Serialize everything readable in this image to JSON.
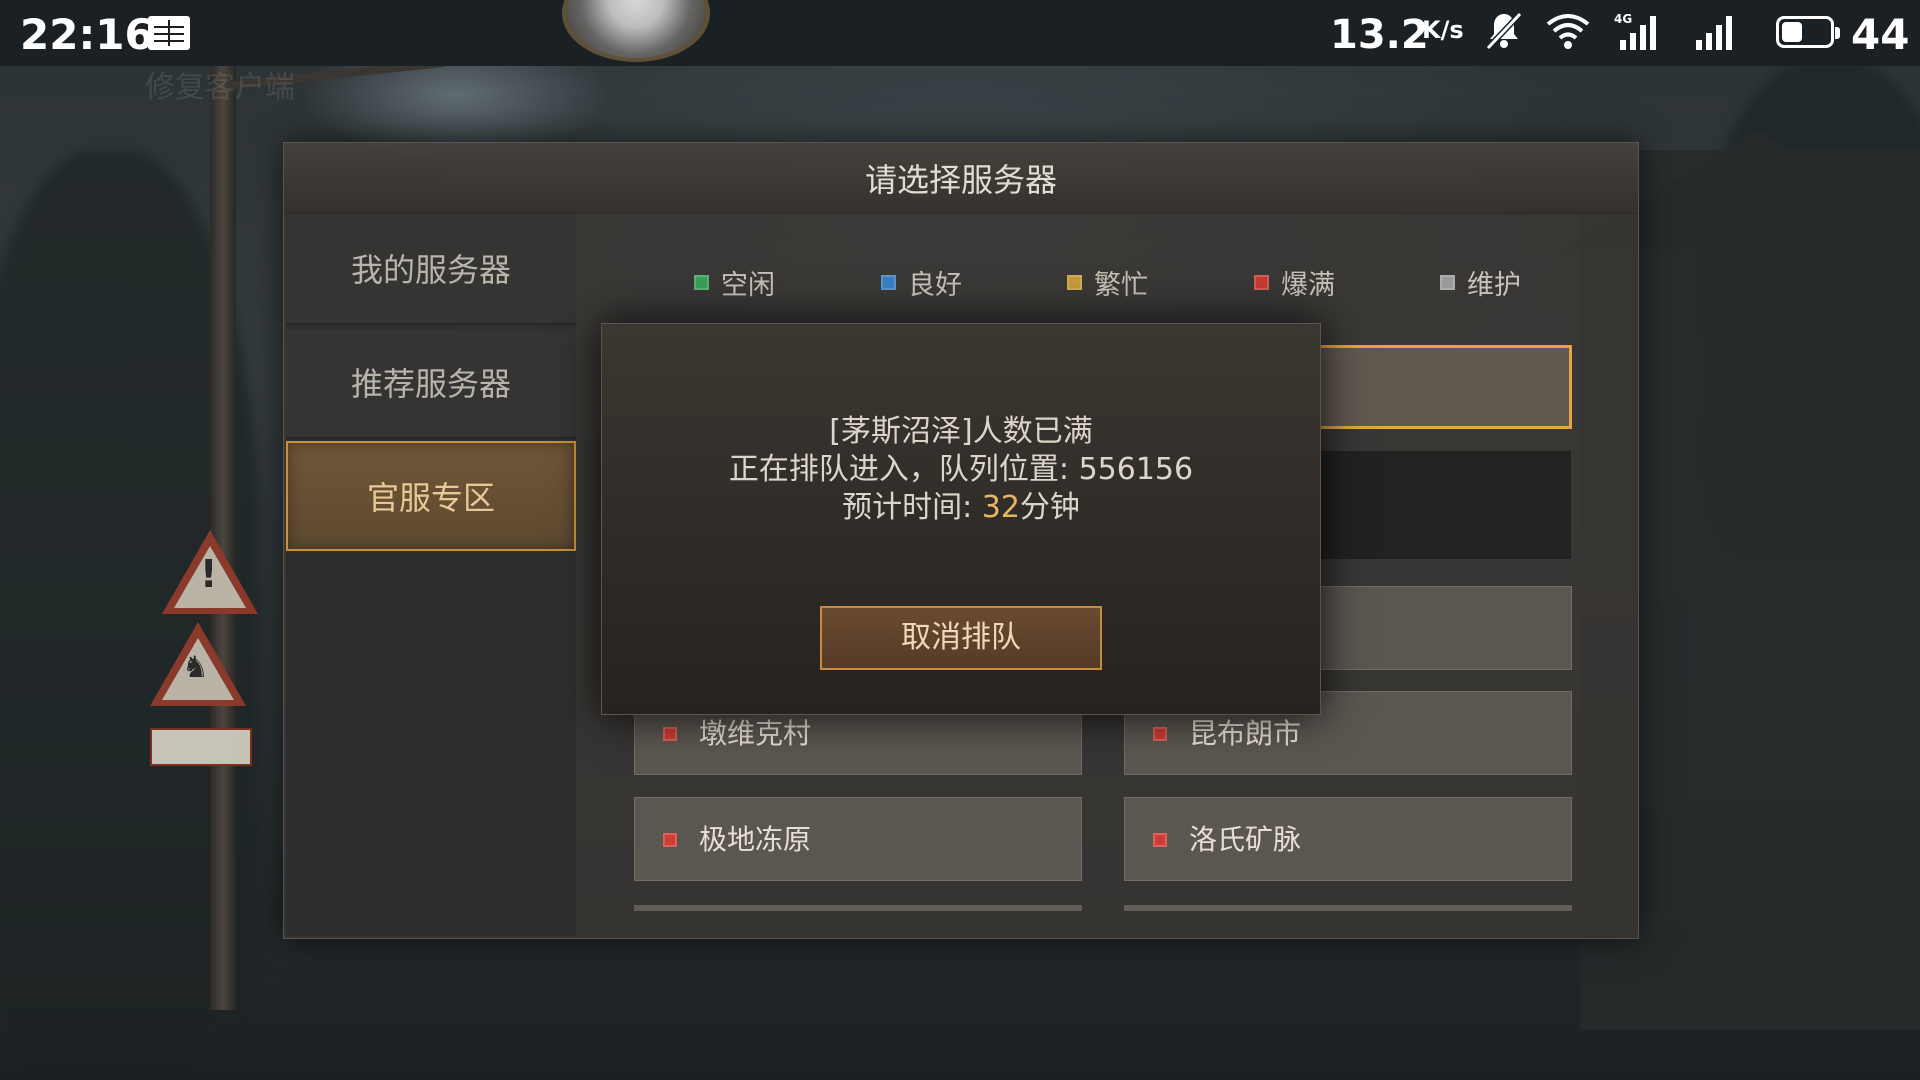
{
  "status_bar": {
    "time": "22:16",
    "speed": "13.2",
    "speed_unit": "K/s",
    "network_type": "4G",
    "battery_level": 44,
    "battery_text": "44",
    "icons": [
      "book-icon",
      "mute-bell-icon",
      "wifi-icon",
      "signal-icon"
    ]
  },
  "watermark": "修复客户端",
  "panel": {
    "title": "请选择服务器",
    "tabs": [
      {
        "label": "我的服务器",
        "active": false
      },
      {
        "label": "推荐服务器",
        "active": false
      },
      {
        "label": "官服专区",
        "active": true
      }
    ],
    "legend": [
      {
        "label": "空闲",
        "color": "#3aa05a"
      },
      {
        "label": "良好",
        "color": "#3a7fc4"
      },
      {
        "label": "繁忙",
        "color": "#c89a3a"
      },
      {
        "label": "爆满",
        "color": "#c83a32"
      },
      {
        "label": "维护",
        "color": "#9a9a9a"
      }
    ],
    "servers": [
      {
        "name": "墩维克村",
        "status_color": "#cd3d33"
      },
      {
        "name": "昆布朗市",
        "status_color": "#cd3d33"
      },
      {
        "name": "极地冻原",
        "status_color": "#cd3d33"
      },
      {
        "name": "洛氏矿脉",
        "status_color": "#cd3d33"
      }
    ]
  },
  "queue_dialog": {
    "line1": "[茅斯沼泽]人数已满",
    "line2_prefix": "正在排队进入，队列位置: ",
    "queue_position": "556156",
    "line3_prefix": "预计时间: ",
    "wait_minutes": "32",
    "line3_suffix": "分钟",
    "cancel_label": "取消排队"
  },
  "colors": {
    "accent": "#c5913f",
    "dialog_highlight": "#e6b566"
  }
}
